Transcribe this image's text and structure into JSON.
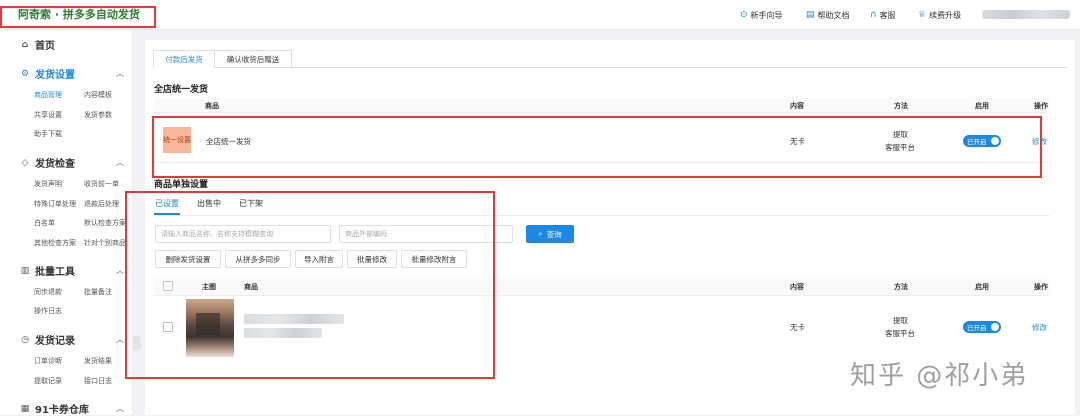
{
  "header": {
    "brand_title": "阿奇索 · 拼多多自动发货",
    "nav": [
      {
        "label": "新手向导",
        "icon": "compass-icon"
      },
      {
        "label": "帮助文档",
        "icon": "document-icon"
      },
      {
        "label": "客服",
        "icon": "headset-icon"
      },
      {
        "label": "续费升级",
        "icon": "upgrade-icon"
      }
    ]
  },
  "sidebar": {
    "home": "首页",
    "sections": [
      {
        "title": "发货设置",
        "active": true,
        "items": [
          "商品管理",
          "内容模板",
          "共享设置",
          "发货参数",
          "助手下载"
        ]
      },
      {
        "title": "发货检查",
        "items": [
          "发货声明",
          "收货前一单",
          "特殊订单处理",
          "退款后处理",
          "白名单",
          "默认检查方案",
          "其他检查方案",
          "针对个别商品"
        ]
      },
      {
        "title": "批量工具",
        "items": [
          "同步退款",
          "批量备注",
          "操作日志"
        ]
      },
      {
        "title": "发货记录",
        "items": [
          "订单诊断",
          "发货结果",
          "提取记录",
          "接口日志"
        ]
      },
      {
        "title": "91卡券仓库",
        "items": []
      }
    ]
  },
  "main": {
    "tabs": [
      "付款后发货",
      "确认收货后赠送"
    ],
    "store_section": {
      "title": "全店统一发货",
      "headers": {
        "product": "商品",
        "content": "内容",
        "method": "方法",
        "enabled": "启用",
        "action": "操作"
      },
      "row": {
        "badge": "统一设置",
        "name": "全店统一发货",
        "content": "无卡",
        "method_line1": "提取",
        "method_line2": "客服平台",
        "toggle": "已开启",
        "action": "修改"
      }
    },
    "single_section": {
      "title": "商品单独设置",
      "subtabs": [
        "已设置",
        "出售中",
        "已下架"
      ],
      "search_placeholder": "请输入商品名称、名称支持模糊查询",
      "code_placeholder": "商品外部编码",
      "search_button": "查询",
      "actions": [
        "删除发货设置",
        "从拼多多同步",
        "导入附言",
        "批量修改",
        "批量修改附言"
      ],
      "headers": {
        "image": "主图",
        "product": "商品",
        "content": "内容",
        "method": "方法",
        "enabled": "启用",
        "action": "操作"
      },
      "row": {
        "content": "无卡",
        "method_line1": "提取",
        "method_line2": "客服平台",
        "toggle": "已开启",
        "action": "修改"
      }
    }
  },
  "watermark": "知乎 @祁小弟",
  "colors": {
    "accent": "#1e88e5",
    "brand": "#2e7d32",
    "highlight": "#e53935",
    "badge": "#f8b99a"
  }
}
